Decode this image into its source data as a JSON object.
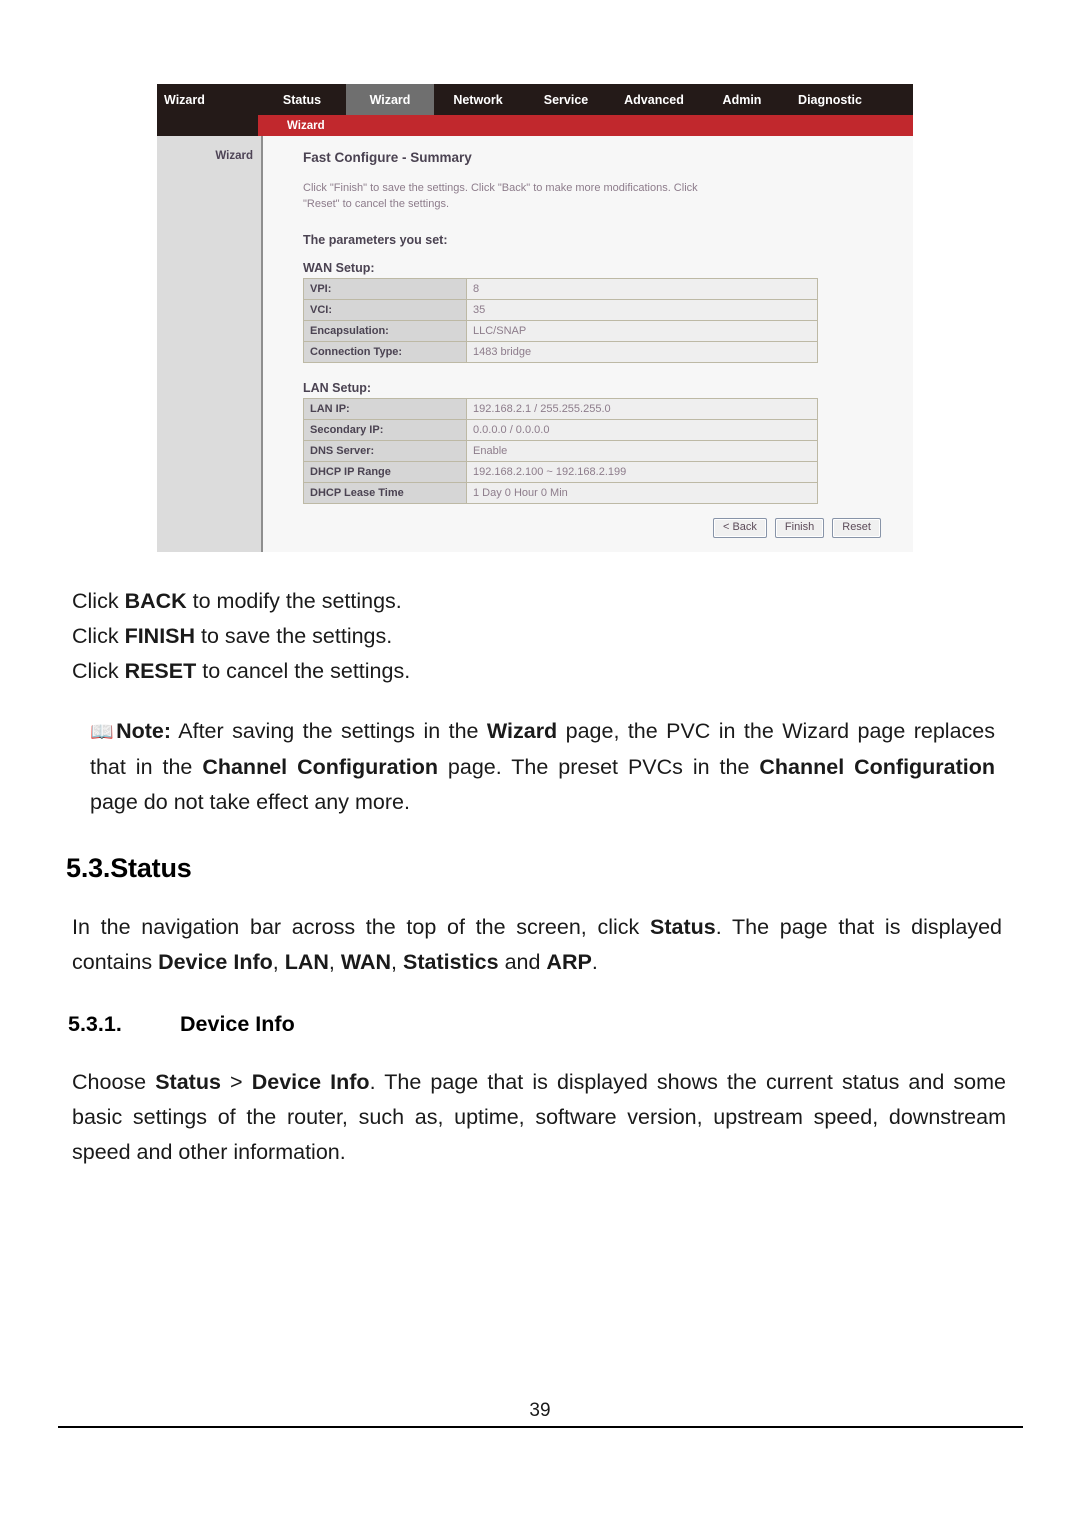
{
  "router_ui": {
    "brand": "Wizard",
    "nav_tabs": [
      {
        "label": "Status",
        "active": false
      },
      {
        "label": "Wizard",
        "active": true
      },
      {
        "label": "Network",
        "active": false
      },
      {
        "label": "Service",
        "active": false
      },
      {
        "label": "Advanced",
        "active": false
      },
      {
        "label": "Admin",
        "active": false
      },
      {
        "label": "Diagnostic",
        "active": false
      }
    ],
    "subnav_label": "Wizard",
    "sidebar_item": "Wizard",
    "content_title": "Fast Configure - Summary",
    "content_desc": "Click \"Finish\" to save the settings. Click \"Back\" to make more modifications. Click \"Reset\" to cancel the settings.",
    "section_lead": "The parameters you set:",
    "wan_setup": {
      "title": "WAN Setup:",
      "rows": [
        {
          "label": "VPI:",
          "value": "8"
        },
        {
          "label": "VCI:",
          "value": "35"
        },
        {
          "label": "Encapsulation:",
          "value": "LLC/SNAP"
        },
        {
          "label": "Connection Type:",
          "value": "1483 bridge"
        }
      ]
    },
    "lan_setup": {
      "title": "LAN Setup:",
      "rows": [
        {
          "label": "LAN IP:",
          "value": "192.168.2.1 / 255.255.255.0"
        },
        {
          "label": "Secondary IP:",
          "value": "0.0.0.0 / 0.0.0.0"
        },
        {
          "label": "DNS Server:",
          "value": "Enable"
        },
        {
          "label": "DHCP IP Range",
          "value": "192.168.2.100 ~ 192.168.2.199"
        },
        {
          "label": "DHCP Lease Time",
          "value": "1 Day 0 Hour 0 Min"
        }
      ]
    },
    "buttons": {
      "back": "< Back",
      "finish": "Finish",
      "reset": "Reset"
    },
    "colors": {
      "nav_background": "#241a18",
      "active_tab": "#6f6f6f",
      "subnav_red": "#c1282d",
      "sidebar": "#dcdcdc",
      "table_label": "#d6d6d6",
      "table_value": "#efefef"
    }
  },
  "document": {
    "click_lines": [
      {
        "pre": "Click ",
        "bold": "BACK",
        "post": " to modify the settings."
      },
      {
        "pre": "Click ",
        "bold": "FINISH",
        "post": " to save the settings."
      },
      {
        "pre": "Click ",
        "bold": "RESET",
        "post": " to cancel the settings."
      }
    ],
    "note": {
      "icon": "📖",
      "label": "Note:",
      "seg1": " After saving the settings in the ",
      "b1": "Wizard",
      "seg2": " page, the PVC in the Wizard page replaces that in the ",
      "b2": "Channel Configuration",
      "seg3": " page. The preset PVCs in the ",
      "b3": "Channel Configuration",
      "seg4": " page do not take effect any more."
    },
    "heading_53": "5.3.Status",
    "para_status": {
      "seg1": "In the navigation bar across the top of the screen, click ",
      "b1": "Status",
      "seg2": ". The page that is displayed contains ",
      "b2": "Device Info",
      "seg3": ", ",
      "b3": "LAN",
      "seg4": ", ",
      "b4": "WAN",
      "seg5": ", ",
      "b5": "Statistics",
      "seg6": " and ",
      "b6": "ARP",
      "seg7": "."
    },
    "heading_531_num": "5.3.1.",
    "heading_531_text": "Device Info",
    "para_deviceinfo": {
      "seg1": "Choose ",
      "b1": "Status",
      "seg2": " > ",
      "b2": "Device Info",
      "seg3": ". The page that is displayed shows the current status and some basic settings of the router, such as, uptime, software version, upstream speed, downstream speed and other information."
    },
    "page_number": "39"
  }
}
